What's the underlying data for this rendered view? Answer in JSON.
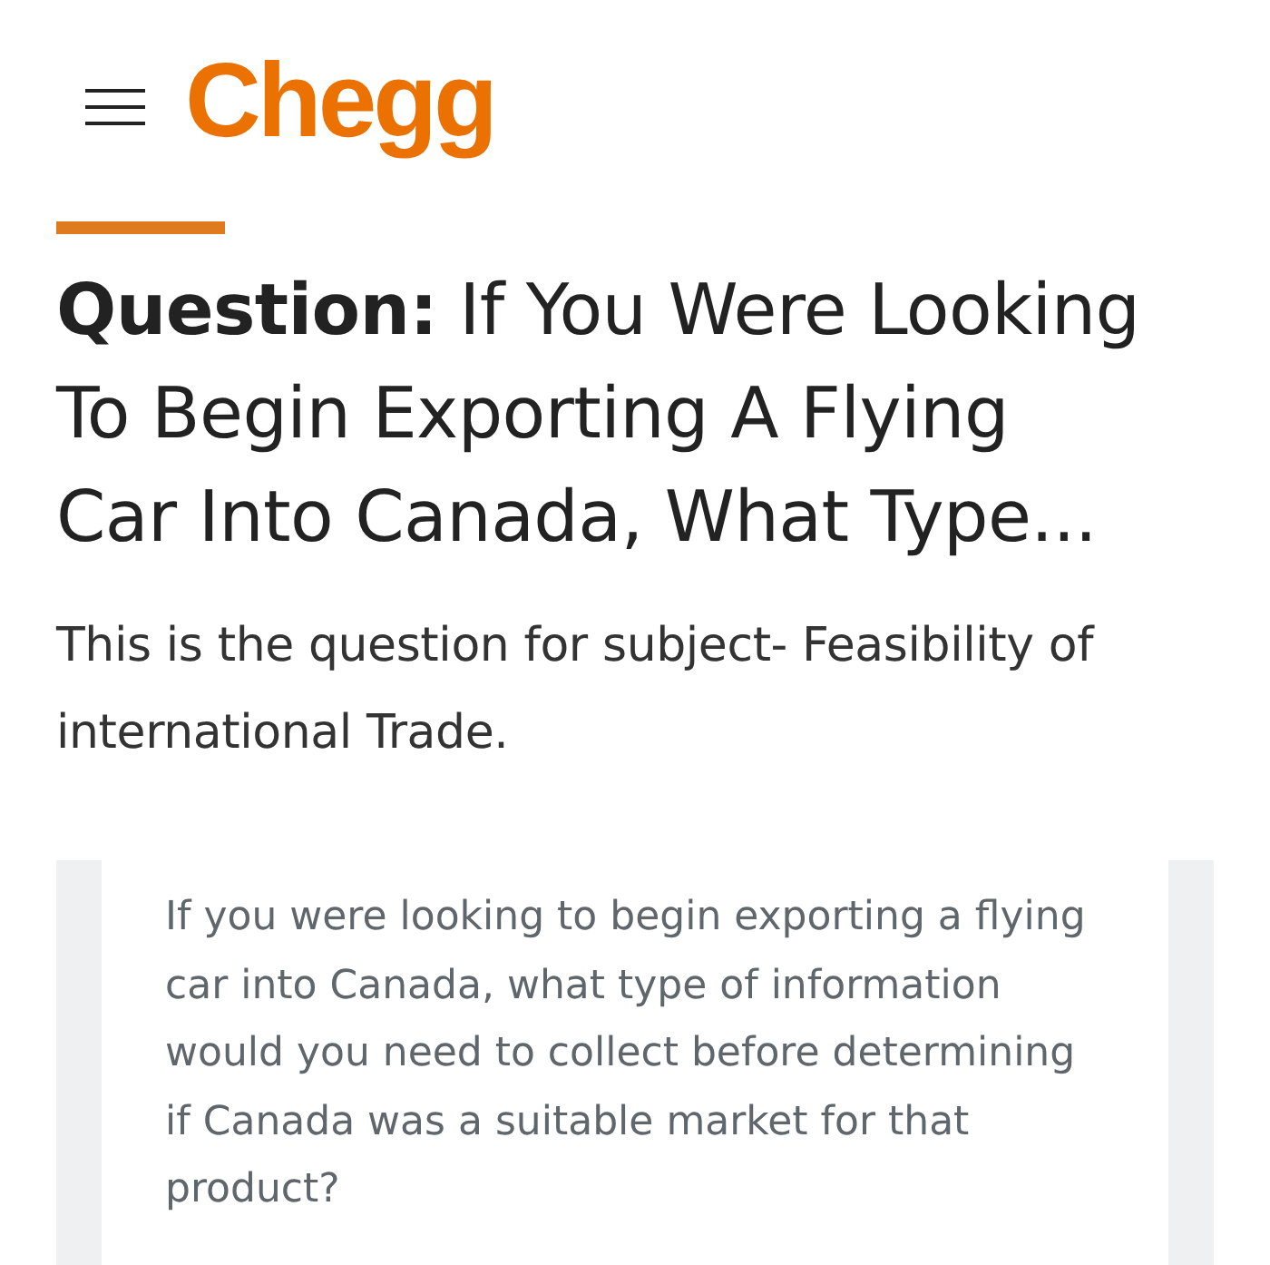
{
  "header": {
    "logo": "Chegg"
  },
  "question": {
    "title": "**Question:** If You Were Looking To Begin Exporting A Flying Car Into Canada, What Type...",
    "subject": "This is the question for subject- Feasibility of international Trade.",
    "body": "If you were looking to begin exporting a flying car into Canada, what type of information would you need to collect before determining if Canada was a suitable market for that product?"
  }
}
